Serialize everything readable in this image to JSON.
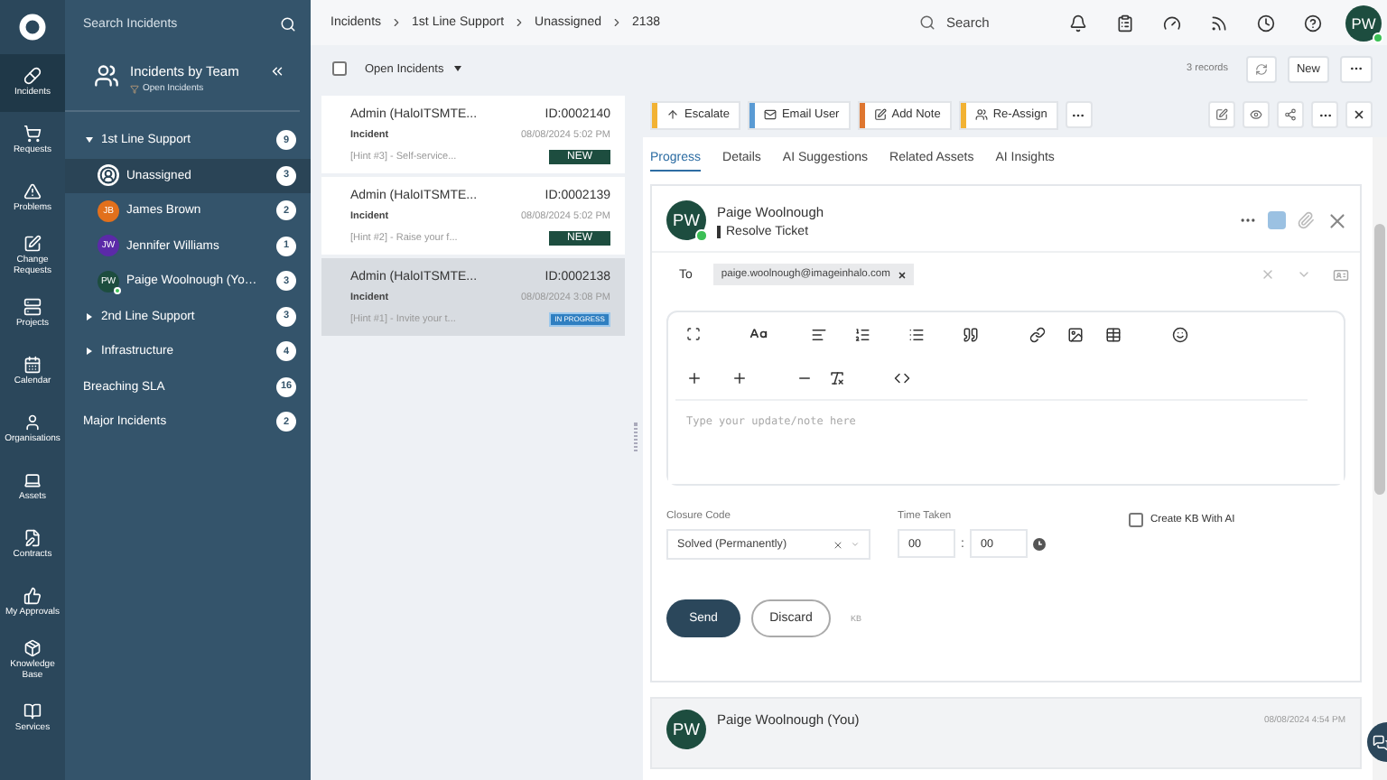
{
  "rail": {
    "items": [
      {
        "label": "Incidents",
        "selected": true
      },
      {
        "label": "Requests",
        "selected": false
      },
      {
        "label": "Problems",
        "selected": false
      },
      {
        "label": "Change Requests",
        "selected": false
      },
      {
        "label": "Projects",
        "selected": false
      },
      {
        "label": "Calendar",
        "selected": false
      },
      {
        "label": "Organisations",
        "selected": false
      },
      {
        "label": "Assets",
        "selected": false
      },
      {
        "label": "Contracts",
        "selected": false
      },
      {
        "label": "My Approvals",
        "selected": false
      },
      {
        "label": "Knowledge Base",
        "selected": false
      },
      {
        "label": "Services",
        "selected": false
      }
    ]
  },
  "teams": {
    "search": {
      "placeholder": "Search Incidents"
    },
    "title": "Incidents by Team",
    "subtitle": "Open Incidents",
    "tree": [
      {
        "kind": "group",
        "label": "1st Line Support",
        "count": "9",
        "expanded": true,
        "children": [
          {
            "kind": "unassigned",
            "label": "Unassigned",
            "count": "3",
            "selected": true
          },
          {
            "kind": "agent",
            "label": "James Brown",
            "initials": "JB",
            "color": "#e2701c",
            "online": false,
            "count": "2",
            "selected": false
          },
          {
            "kind": "agent",
            "label": "Jennifer Williams",
            "initials": "JW",
            "color": "#5b2aa8",
            "online": false,
            "count": "1",
            "selected": false
          },
          {
            "kind": "agent",
            "label": "Paige Woolnough (Yo…",
            "initials": "PW",
            "color": "#1d4d3f",
            "online": true,
            "count": "3",
            "selected": false
          }
        ]
      },
      {
        "kind": "group",
        "label": "2nd Line Support",
        "count": "3",
        "expanded": false
      },
      {
        "kind": "group",
        "label": "Infrastructure",
        "count": "4",
        "expanded": false
      },
      {
        "kind": "view",
        "label": "Breaching SLA",
        "count": "16"
      },
      {
        "kind": "view",
        "label": "Major Incidents",
        "count": "2"
      }
    ]
  },
  "topbar": {
    "breadcrumbs": [
      "Incidents",
      "1st Line Support",
      "Unassigned",
      "2138"
    ],
    "search": {
      "placeholder": "Search"
    },
    "avatar": {
      "initials": "PW",
      "online": true
    }
  },
  "list_toolbar": {
    "select_all": {
      "checked": false
    },
    "filter": "Open Incidents",
    "records": "3 records",
    "new_button": "New"
  },
  "tickets": [
    {
      "requester": "Admin (HaloITSMTE...",
      "id": "ID:0002140",
      "type": "Incident",
      "date": "08/08/2024 5:02 PM",
      "summary": "[Hint #3] - Self-service...",
      "status": {
        "label": "NEW",
        "kind": "new"
      },
      "selected": false
    },
    {
      "requester": "Admin (HaloITSMTE...",
      "id": "ID:0002139",
      "type": "Incident",
      "date": "08/08/2024 5:02 PM",
      "summary": "[Hint #2] - Raise your f...",
      "status": {
        "label": "NEW",
        "kind": "new"
      },
      "selected": false
    },
    {
      "requester": "Admin (HaloITSMTE...",
      "id": "ID:0002138",
      "type": "Incident",
      "date": "08/08/2024 3:08 PM",
      "summary": "[Hint #1] - Invite your t...",
      "status": {
        "label": "IN PROGRESS",
        "kind": "in_progress"
      },
      "selected": true
    }
  ],
  "actions": [
    {
      "label": "Escalate",
      "color": "#f2b233"
    },
    {
      "label": "Email User",
      "color": "#5a9bd4"
    },
    {
      "label": "Add Note",
      "color": "#de7630"
    },
    {
      "label": "Re-Assign",
      "color": "#f2b233"
    }
  ],
  "tabs": [
    {
      "label": "Progress",
      "selected": true
    },
    {
      "label": "Details",
      "selected": false
    },
    {
      "label": "AI Suggestions",
      "selected": false
    },
    {
      "label": "Related Assets",
      "selected": false
    },
    {
      "label": "AI Insights",
      "selected": false
    }
  ],
  "composer": {
    "avatar": {
      "initials": "PW",
      "online": true
    },
    "author": "Paige Woolnough",
    "action": "Resolve Ticket",
    "to_label": "To",
    "recipients": [
      "paige.woolnough@imageinhalo.com"
    ],
    "placeholder": "Type your update/note here",
    "closure_code": {
      "label": "Closure Code",
      "value": "Solved (Permanently)"
    },
    "time_taken": {
      "label": "Time Taken",
      "hours": "00",
      "separator": ":",
      "minutes": "00"
    },
    "create_kb": {
      "label": "Create KB With AI",
      "checked": false
    },
    "send": "Send",
    "discard": "Discard",
    "kb": "KB"
  },
  "history": [
    {
      "avatar": {
        "initials": "PW"
      },
      "author": "Paige Woolnough (You)",
      "date": "08/08/2024 4:54 PM"
    }
  ]
}
